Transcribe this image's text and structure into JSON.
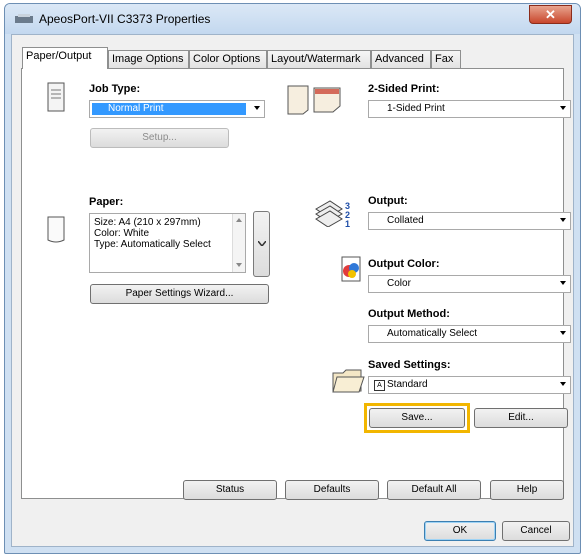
{
  "window": {
    "title": "ApeosPort-VII C3373 Properties",
    "close_label": "✕"
  },
  "tabs": [
    "Paper/Output",
    "Image Options",
    "Color Options",
    "Layout/Watermark",
    "Advanced",
    "Fax"
  ],
  "job_type": {
    "label": "Job Type:",
    "value": "Normal Print",
    "setup_label": "Setup..."
  },
  "paper": {
    "label": "Paper:",
    "lines": [
      "Size: A4 (210 x 297mm)",
      "Color: White",
      "Type: Automatically Select"
    ],
    "wizard_label": "Paper Settings Wizard..."
  },
  "two_sided": {
    "label": "2-Sided Print:",
    "value": "1-Sided Print"
  },
  "output": {
    "label": "Output:",
    "value": "Collated"
  },
  "output_color": {
    "label": "Output Color:",
    "value": "Color"
  },
  "output_method": {
    "label": "Output Method:",
    "value": "Automatically Select"
  },
  "saved_settings": {
    "label": "Saved Settings:",
    "value": "Standard",
    "save_label": "Save...",
    "edit_label": "Edit..."
  },
  "bottom_buttons": {
    "status": "Status",
    "defaults": "Defaults",
    "default_all": "Default All",
    "help": "Help"
  },
  "dialog_buttons": {
    "ok": "OK",
    "cancel": "Cancel"
  },
  "colors": {
    "highlight": "#f2b600",
    "selected": "#3399ff"
  }
}
